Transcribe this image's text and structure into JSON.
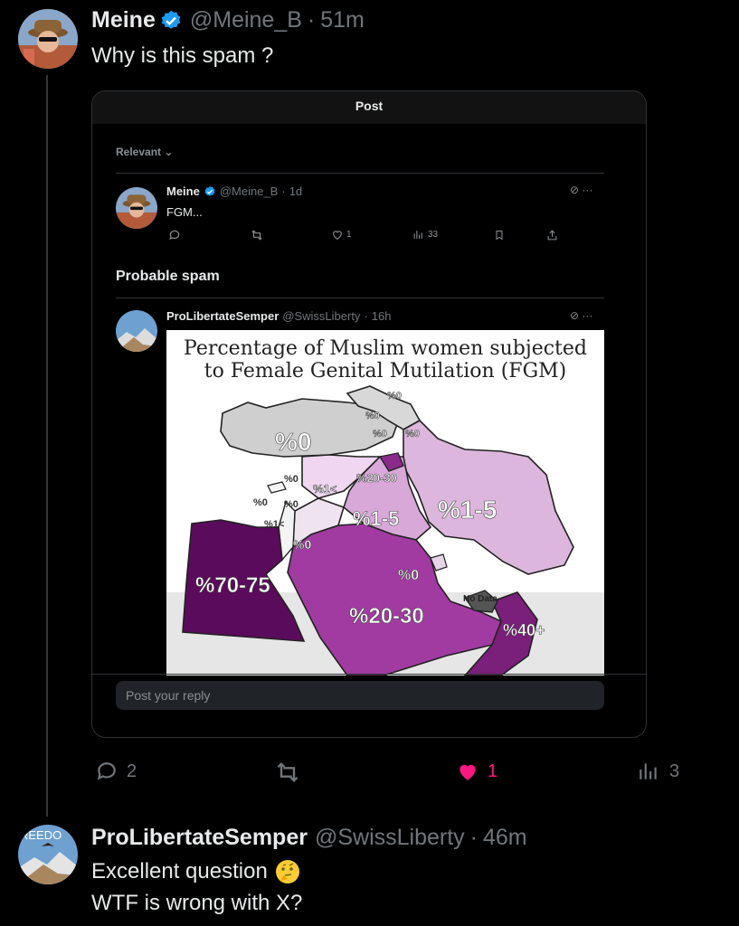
{
  "tweet1": {
    "name": "Meine",
    "handle": "@Meine_B",
    "time": "51m",
    "text": "Why is this spam ?",
    "actions": {
      "replies": "2",
      "likes": "1",
      "views": "3"
    }
  },
  "card": {
    "title": "Post",
    "sort_label": "Relevant",
    "post1": {
      "name": "Meine",
      "handle": "@Meine_B",
      "time": "1d",
      "text": "FGM...",
      "likes": "1",
      "views": "33"
    },
    "spam_heading": "Probable spam",
    "post2": {
      "name": "ProLibertateSemper",
      "handle": "@SwissLiberty",
      "time": "16h"
    },
    "map": {
      "title_line1": "Percentage of Muslim women subjected",
      "title_line2": "to Female Genital Mutilation (FGM)",
      "labels": {
        "turkey": "%0",
        "iran": "%1-5",
        "iraq": "%1-5",
        "kuwait_area": "%20-30",
        "syria": "%1<",
        "lebanon1": "%0",
        "lebanon2": "%0",
        "cyprus": "%0",
        "israel": "%0",
        "palestine": "%1<",
        "jordan": "%0",
        "gulf": "%0",
        "egypt": "%70-75",
        "saudi": "%20-30",
        "oman": "%40+",
        "uae": "No Data",
        "caucasus1": "%0",
        "caucasus2": "%0",
        "caucasus3": "%0",
        "caucasus4": "%0"
      }
    },
    "reply_placeholder": "Post your reply"
  },
  "tweet2": {
    "name": "ProLibertateSemper",
    "handle": "@SwissLiberty",
    "time": "46m",
    "line1": "Excellent question",
    "line2": "WTF is wrong with X?",
    "avatar_text": "REEDO"
  },
  "colors": {
    "background": "#000000",
    "text": "#e7e9ea",
    "muted": "#71767b",
    "verified": "#1d9bf0",
    "like": "#f91880"
  }
}
